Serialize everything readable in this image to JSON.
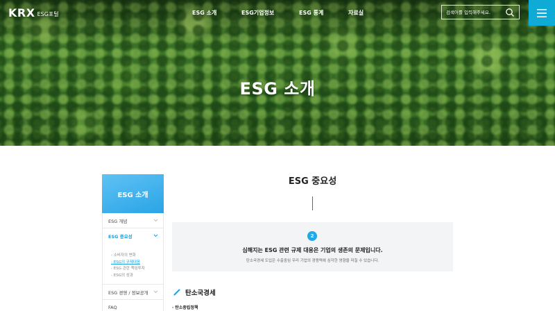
{
  "header": {
    "logo_mark": "KRX",
    "logo_sub": "ESG포털",
    "nav": [
      "ESG 소개",
      "ESG기업정보",
      "ESG 통계",
      "자료실"
    ],
    "search_placeholder": "검색어를 입력해주세요."
  },
  "hero": {
    "title": "ESG 소개"
  },
  "sidebar": {
    "heading": "ESG 소개",
    "items": [
      {
        "label": "ESG 개념"
      },
      {
        "label": "ESG 중요성"
      }
    ],
    "subitems": [
      "소비자의 변화",
      "ESG의 규제대응",
      "ESG 관련 책임투자",
      "ESG의 성과"
    ],
    "current_subitem": "ESG의 규제대응",
    "after_items": [
      {
        "label": "ESG 경영 / 정보공개"
      }
    ],
    "faq": "FAQ"
  },
  "main": {
    "title": "ESG 중요성",
    "box": {
      "number": "2",
      "title": "심해지는 ESG 관련 규제 대응은 기업의 생존의 문제입니다.",
      "description": "탄소국경세 도입은 수출중심 우리 기업의 경쟁력에 심각한 영향을 미칠 수 있습니다."
    },
    "section_title": "탄소국경세",
    "sub_heading": "· 탄소중립정책"
  },
  "colors": {
    "accent": "#0eabd6",
    "sidebar_head": "#2aa4e6",
    "active_link": "#1ba0e0",
    "info_box_bg": "#f3f4f6"
  }
}
